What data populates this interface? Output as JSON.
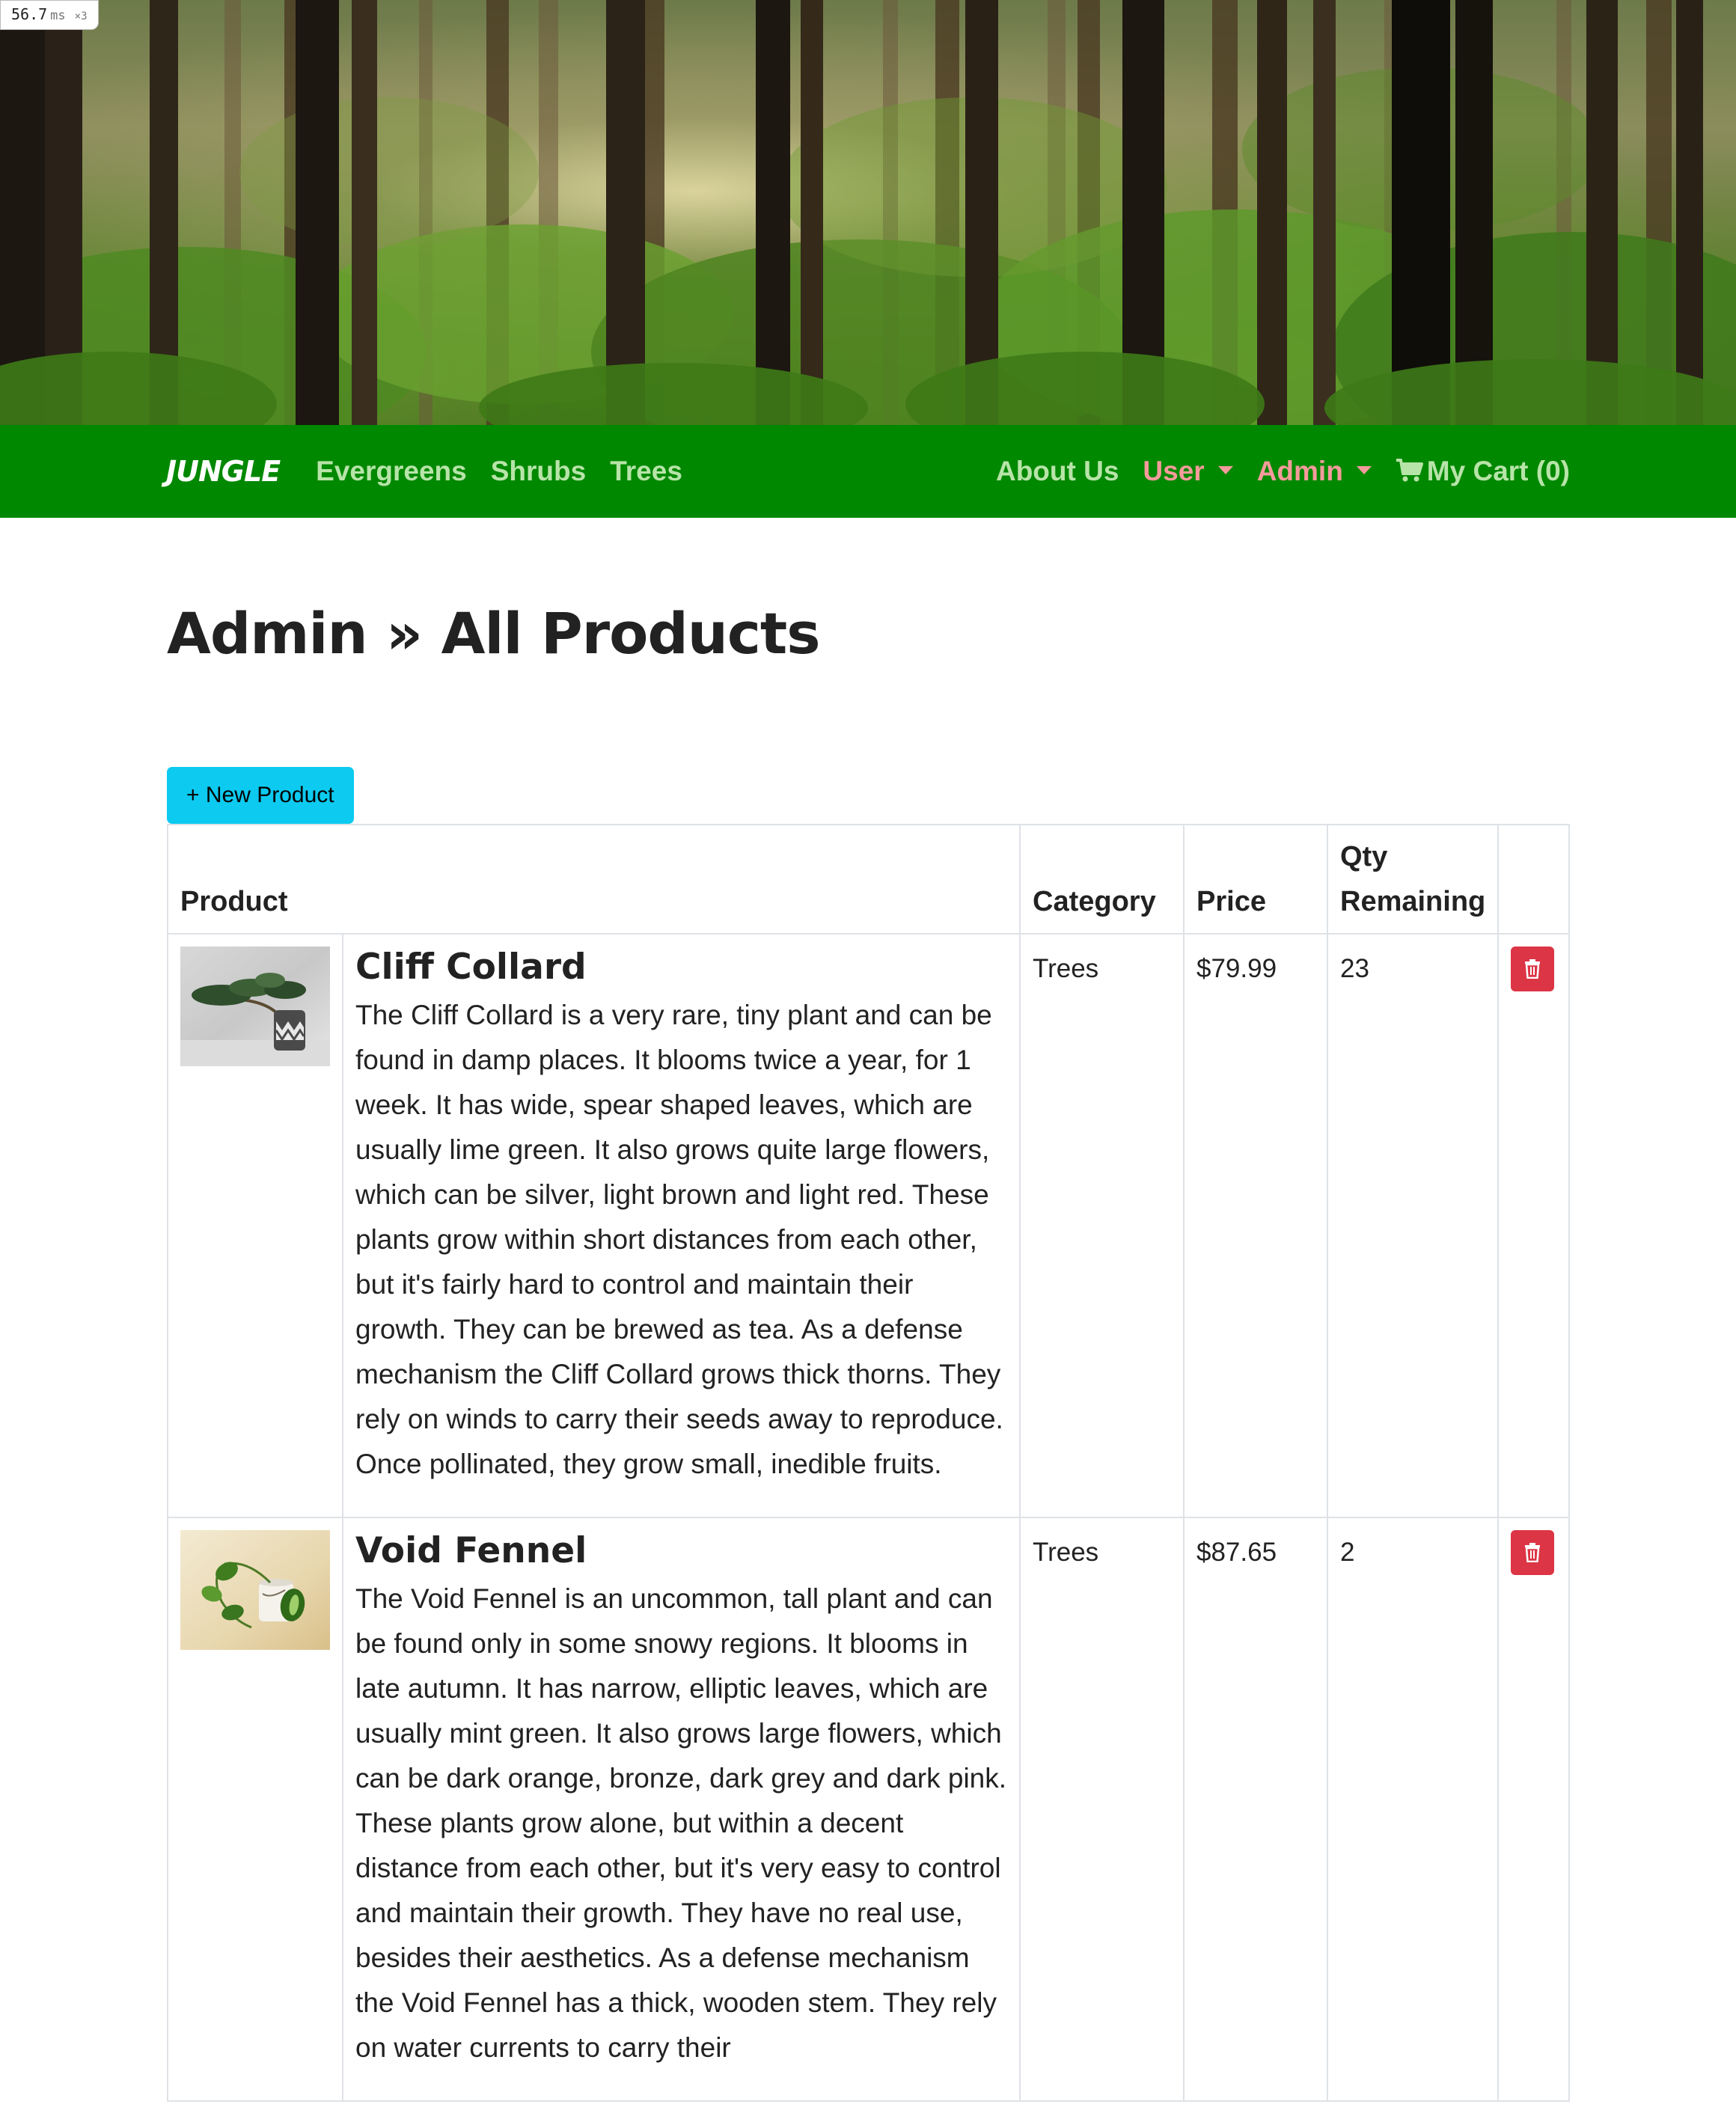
{
  "perf": {
    "value": "56.7",
    "unit": "ms",
    "mult": "×3"
  },
  "nav": {
    "brand": "JUNGLE",
    "left_links": [
      "Evergreens",
      "Shrubs",
      "Trees"
    ],
    "about": "About Us",
    "user": "User",
    "admin": "Admin",
    "cart": "My Cart (0)"
  },
  "colors": {
    "navbar": "#008800",
    "nav_link": "#b7e4a8",
    "nav_dropdown": "#f49b9b",
    "new_button": "#0dcaf0",
    "delete_button": "#dc3545"
  },
  "icons": {
    "cart": "shopping-cart-icon",
    "delete": "trash-icon"
  },
  "page": {
    "title": "Admin » All Products",
    "new_button": "+ New Product"
  },
  "table": {
    "headers": {
      "product": "Product",
      "category": "Category",
      "price": "Price",
      "qty": "Qty Remaining"
    },
    "rows": [
      {
        "name": "Cliff Collard",
        "description": "The Cliff Collard is a very rare, tiny plant and can be found in damp places. It blooms twice a year, for 1 week. It has wide, spear shaped leaves, which are usually lime green. It also grows quite large flowers, which can be silver, light brown and light red. These plants grow within short distances from each other, but it's fairly hard to control and maintain their growth. They can be brewed as tea. As a defense mechanism the Cliff Collard grows thick thorns. They rely on winds to carry their seeds away to reproduce. Once pollinated, they grow small, inedible fruits.",
        "category": "Trees",
        "price": "$79.99",
        "qty": "23"
      },
      {
        "name": "Void Fennel",
        "description": "The Void Fennel is an uncommon, tall plant and can be found only in some snowy regions. It blooms in late autumn. It has narrow, elliptic leaves, which are usually mint green. It also grows large flowers, which can be dark orange, bronze, dark grey and dark pink. These plants grow alone, but within a decent distance from each other, but it's very easy to control and maintain their growth. They have no real use, besides their aesthetics. As a defense mechanism the Void Fennel has a thick, wooden stem. They rely on water currents to carry their",
        "category": "Trees",
        "price": "$87.65",
        "qty": "2"
      }
    ]
  }
}
